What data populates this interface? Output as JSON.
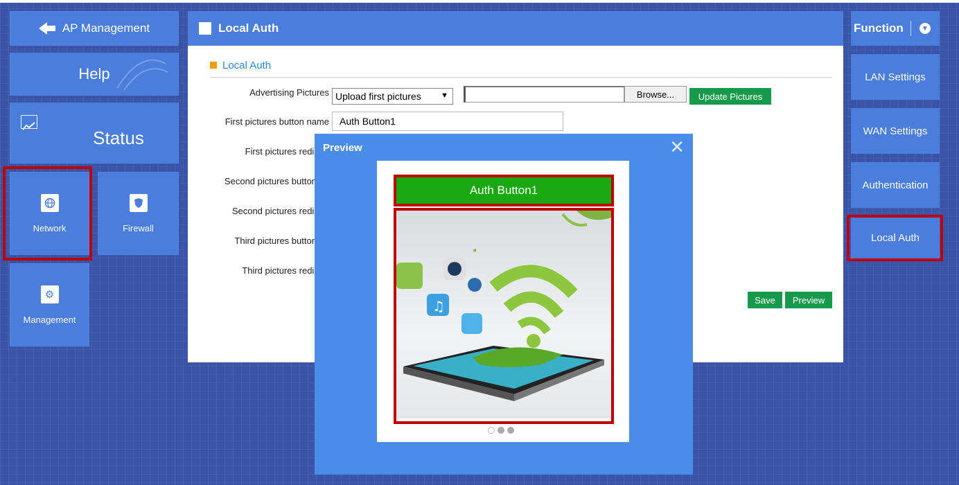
{
  "left_nav": {
    "ap_management": "AP Management",
    "help": "Help",
    "status": "Status",
    "network": "Network",
    "firewall": "Firewall",
    "management": "Management"
  },
  "main": {
    "header_title": "Local Auth",
    "section_title": "Local Auth",
    "labels": {
      "advertising_pictures": "Advertising Pictures",
      "first_button_name": "First pictures button name",
      "first_redirect": "First pictures redirect",
      "second_button_name": "Second pictures button na",
      "second_redirect": "Second pictures redirect",
      "third_button_name": "Third pictures button na",
      "third_redirect": "Third pictures redirect"
    },
    "select_value": "Upload first pictures",
    "browse_label": "Browse...",
    "update_pictures_label": "Update Pictures",
    "first_button_value": "Auth Button1",
    "save_label": "Save",
    "preview_label": "Preview"
  },
  "right_nav": {
    "function": "Function",
    "lan_settings": "LAN Settings",
    "wan_settings": "WAN Settings",
    "authentication": "Authentication",
    "local_auth": "Local Auth"
  },
  "modal": {
    "title": "Preview",
    "auth_button_label": "Auth Button1",
    "carousel": {
      "total": 3,
      "active": 1
    }
  },
  "colors": {
    "background": "#3a55a8",
    "tile": "#4a7ddc",
    "highlight": "#c00000",
    "green": "#189a4c",
    "auth_green": "#1aa812"
  },
  "icons": {
    "back": "arrow-left-icon",
    "status": "chart-icon",
    "network": "globe-icon",
    "firewall": "shield-icon",
    "management": "gear-icon",
    "function": "chevron-down-icon",
    "close": "close-icon"
  }
}
